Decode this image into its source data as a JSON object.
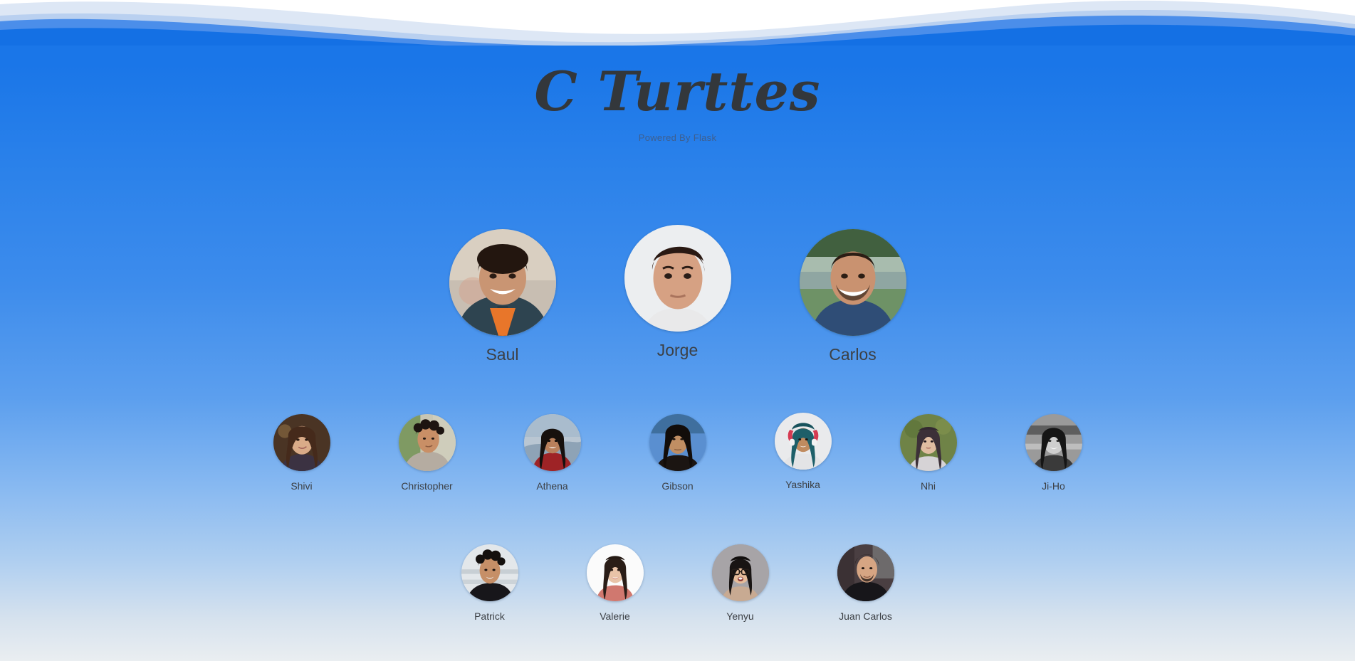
{
  "header": {
    "title": "C Turttes",
    "subtitle": "Powered By Flask",
    "wave_icon": "wave-decoration"
  },
  "colors": {
    "background_top": "#1a76e8",
    "background_bottom": "#eaeef1",
    "wave_pale": "#dde7f5",
    "wave_light": "#b9d0f0",
    "wave_mid": "#4b8eea",
    "wave_deep": "#1470e4",
    "title_text": "#33373b",
    "subtitle_text": "#3e5f8f",
    "name_text": "#3c4045"
  },
  "rows": [
    {
      "id": "leads",
      "members": [
        {
          "name": "Saul",
          "avatar": "avatar-saul",
          "skin": "#c99573",
          "hair": "#23160f",
          "top": "#2e4450",
          "bg": "#d9cfc1"
        },
        {
          "name": "Jorge",
          "avatar": "avatar-jorge",
          "skin": "#d6a183",
          "hair": "#33201a",
          "top": "#e9e9ea",
          "bg": "#eceef0"
        },
        {
          "name": "Carlos",
          "avatar": "avatar-carlos",
          "skin": "#c99270",
          "hair": "#2b1d14",
          "top": "#2f4d76",
          "bg": "#5f7a63"
        }
      ]
    },
    {
      "id": "team",
      "members": [
        {
          "name": "Shivi",
          "avatar": "avatar-shivi",
          "skin": "#d9ab88",
          "hair": "#452a1b",
          "top": "#3b3242",
          "bg": "#4a3424"
        },
        {
          "name": "Christopher",
          "avatar": "avatar-christopher",
          "skin": "#c98f66",
          "hair": "#1d1410",
          "top": "#b5aca1",
          "bg": "#8f9a7e"
        },
        {
          "name": "Athena",
          "avatar": "avatar-athena",
          "skin": "#b9805c",
          "hair": "#16100d",
          "top": "#9e2326",
          "bg": "#9fb0c0"
        },
        {
          "name": "Gibson",
          "avatar": "avatar-gibson",
          "skin": "#c08e63",
          "hair": "#120d0a",
          "top": "#1b1512",
          "bg": "#5a8fd0"
        },
        {
          "name": "Yashika",
          "avatar": "avatar-yashika",
          "skin": "#c08b5f",
          "hair": "#1d5f69",
          "top": "#e3e4e6",
          "bg": "#e9eaec"
        },
        {
          "name": "Nhi",
          "avatar": "avatar-nhi",
          "skin": "#e0bda1",
          "hair": "#3c3038",
          "top": "#d6d3d6",
          "bg": "#6f8347"
        },
        {
          "name": "Ji-Ho",
          "avatar": "avatar-jiho",
          "skin": "#cfcfcf",
          "hair": "#151515",
          "top": "#3a3a3a",
          "bg": "#8c8c8c"
        }
      ]
    },
    {
      "id": "team-two",
      "members": [
        {
          "name": "Patrick",
          "avatar": "avatar-patrick",
          "skin": "#c68f67",
          "hair": "#14100e",
          "top": "#17161a",
          "bg": "#e3e7ea"
        },
        {
          "name": "Valerie",
          "avatar": "avatar-valerie",
          "skin": "#e8c3a8",
          "hair": "#2a1d17",
          "top": "#d0786f",
          "bg": "#fbfbfb"
        },
        {
          "name": "Yenyu",
          "avatar": "avatar-yenyu",
          "skin": "#e6bc9a",
          "hair": "#181413",
          "top": "#c8aa92",
          "bg": "#9d9a9d"
        },
        {
          "name": "Juan Carlos",
          "avatar": "avatar-juancarlos",
          "skin": "#d6a583",
          "hair": "#241a16",
          "top": "#17161a",
          "bg": "#4a3f42"
        }
      ]
    }
  ]
}
